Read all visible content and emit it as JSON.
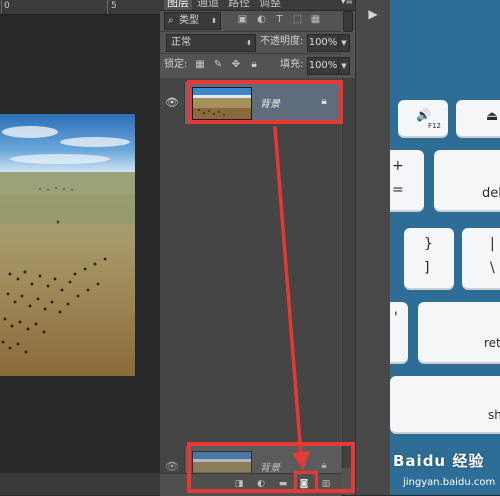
{
  "ruler": {
    "labels": [
      "0",
      "5"
    ]
  },
  "layers_panel": {
    "tabs": [
      {
        "label": "图层",
        "active": true
      },
      {
        "label": "通道",
        "active": false
      },
      {
        "label": "路径",
        "active": false
      },
      {
        "label": "调整",
        "active": false
      }
    ],
    "menu_icon": "panel-menu-icon",
    "filter_kind": "类型",
    "filter_icons": [
      "image-filter-icon",
      "adjustment-filter-icon",
      "text-filter-icon",
      "shape-filter-icon",
      "smart-object-filter-icon"
    ],
    "blend_mode": "正常",
    "opacity_label": "不透明度:",
    "opacity_value": "100%",
    "lock_label": "锁定:",
    "lock_icons": [
      "lock-transparent-icon",
      "lock-paint-icon",
      "lock-move-icon",
      "lock-all-icon"
    ],
    "fill_label": "填充:",
    "fill_value": "100%",
    "layers": [
      {
        "name": "背景",
        "locked": true,
        "selected": true
      },
      {
        "name": "背景",
        "locked": true,
        "selected": false
      }
    ],
    "bottom_icons": [
      "mask-icon",
      "fx-icon",
      "group-folder-icon",
      "new-layer-icon",
      "delete-layer-icon"
    ]
  },
  "keyboard": {
    "keys": [
      {
        "label": "🔊",
        "sub": "F12"
      },
      {
        "label": "⏏"
      },
      {
        "label": "+"
      },
      {
        "label": "="
      },
      {
        "label": "del"
      },
      {
        "label": "}"
      },
      {
        "label": "]"
      },
      {
        "label": "|"
      },
      {
        "label": "\\"
      },
      {
        "label": "'"
      },
      {
        "label": "ret"
      },
      {
        "label": "sh"
      }
    ]
  },
  "watermark": {
    "line1": "Baidu 经验",
    "line2": "jingyan.baidu.com"
  },
  "colors": {
    "highlight": "#e53935",
    "panel_bg": "#535353",
    "selected_layer": "#5f6c7b",
    "keyboard_bg": "#2d6d96"
  }
}
